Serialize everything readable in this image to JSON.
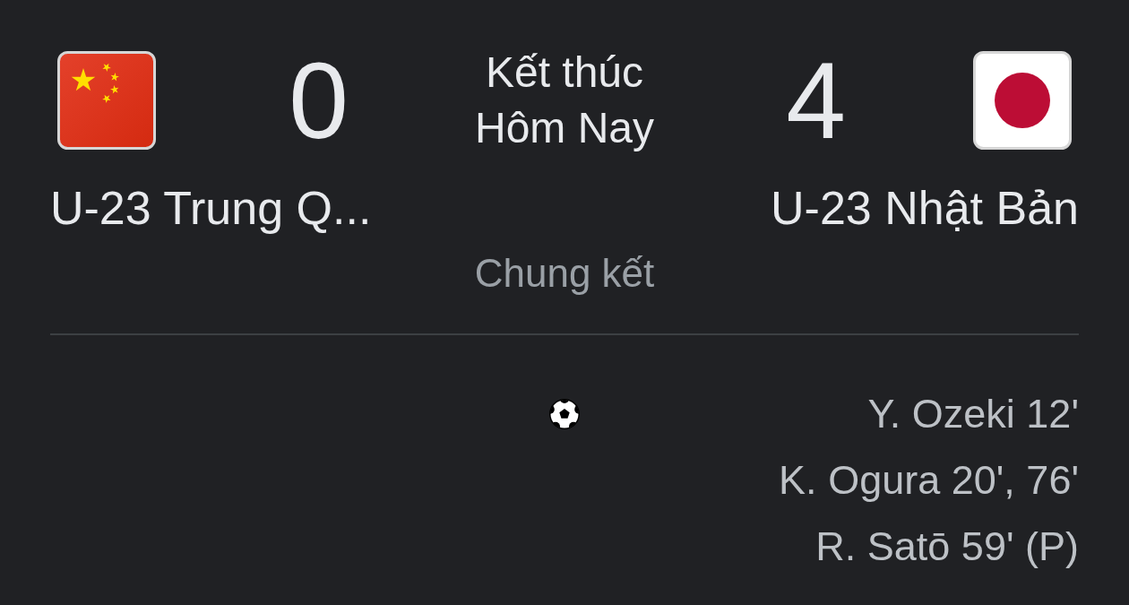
{
  "match": {
    "status": "Kết thúc",
    "date": "Hôm Nay",
    "stage": "Chung kết"
  },
  "home": {
    "team": "U-23 Trung Q...",
    "score": "0"
  },
  "away": {
    "team": "U-23 Nhật Bản",
    "score": "4"
  },
  "goals": {
    "away": [
      "Y. Ozeki 12'",
      "K. Ogura 20', 76'",
      "R. Satō 59' (P)"
    ]
  }
}
